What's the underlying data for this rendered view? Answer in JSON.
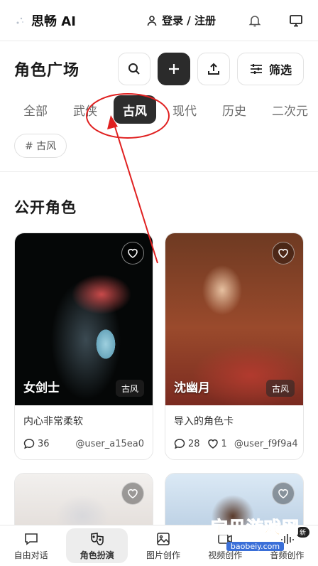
{
  "header": {
    "brand": "思畅 AI",
    "login_label": "登录 / 注册"
  },
  "page": {
    "title": "角色广场",
    "filter_label": "筛选"
  },
  "tabs": [
    {
      "label": "全部",
      "active": false
    },
    {
      "label": "武侠",
      "active": false
    },
    {
      "label": "古风",
      "active": true
    },
    {
      "label": "现代",
      "active": false
    },
    {
      "label": "历史",
      "active": false
    },
    {
      "label": "二次元",
      "active": false
    }
  ],
  "active_tag": "# 古风",
  "section_title": "公开角色",
  "cards": [
    {
      "name": "女剑士",
      "tag": "古风",
      "desc": "内心非常柔软",
      "comments": "36",
      "likes": "",
      "user": "@user_a15ea0"
    },
    {
      "name": "沈幽月",
      "tag": "古风",
      "desc": "导入的角色卡",
      "comments": "28",
      "likes": "1",
      "user": "@user_f9f9a4"
    }
  ],
  "nav": [
    {
      "label": "自由对话",
      "icon": "chat-icon"
    },
    {
      "label": "角色扮演",
      "icon": "masks-icon",
      "active": true
    },
    {
      "label": "图片创作",
      "icon": "image-icon"
    },
    {
      "label": "视频创作",
      "icon": "video-icon"
    },
    {
      "label": "音频创作",
      "icon": "audio-icon",
      "badge": "新"
    }
  ],
  "watermark": {
    "text": "宝贝游戏网",
    "url": "baobeiy.com"
  },
  "colors": {
    "active_tab_bg": "#2d2d2d",
    "annotation": "#e02020"
  }
}
